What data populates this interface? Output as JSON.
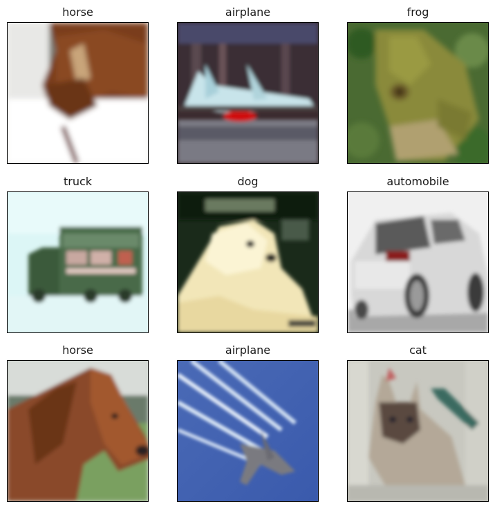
{
  "figure": {
    "images": [
      {
        "label": "horse",
        "subject": "horse-head-profile-photo"
      },
      {
        "label": "airplane",
        "subject": "jet-on-runway-photo"
      },
      {
        "label": "frog",
        "subject": "frog-on-leaves-photo"
      },
      {
        "label": "truck",
        "subject": "green-truck-photo"
      },
      {
        "label": "dog",
        "subject": "white-fluffy-dog-photo"
      },
      {
        "label": "automobile",
        "subject": "white-hatchback-rear-photo"
      },
      {
        "label": "horse",
        "subject": "brown-horse-field-photo"
      },
      {
        "label": "airplane",
        "subject": "plane-contrails-sky-photo"
      },
      {
        "label": "cat",
        "subject": "siamese-cat-sink-photo"
      }
    ]
  }
}
